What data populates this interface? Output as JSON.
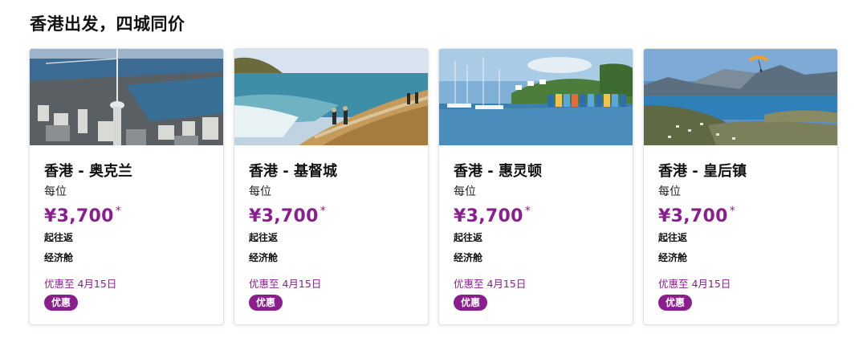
{
  "section": {
    "title": "香港出发，四城同价"
  },
  "cards": [
    {
      "route": "香港 - 奥克兰",
      "per": "每位",
      "price": "¥3,700",
      "star": "*",
      "trip": "起往返",
      "cabin": "经济舱",
      "deal_date": "优惠至 4月15日",
      "badge": "优惠",
      "image_icon": "auckland-city-photo"
    },
    {
      "route": "香港 - 基督城",
      "per": "每位",
      "price": "¥3,700",
      "star": "*",
      "trip": "起往返",
      "cabin": "经济舱",
      "deal_date": "优惠至 4月15日",
      "badge": "优惠",
      "image_icon": "christchurch-coast-photo"
    },
    {
      "route": "香港 - 惠灵顿",
      "per": "每位",
      "price": "¥3,700",
      "star": "*",
      "trip": "起往返",
      "cabin": "经济舱",
      "deal_date": "优惠至 4月15日",
      "badge": "优惠",
      "image_icon": "wellington-harbour-photo"
    },
    {
      "route": "香港 - 皇后镇",
      "per": "每位",
      "price": "¥3,700",
      "star": "*",
      "trip": "起往返",
      "cabin": "经济舱",
      "deal_date": "优惠至 4月15日",
      "badge": "优惠",
      "image_icon": "queenstown-lake-photo"
    }
  ],
  "colors": {
    "accent": "#8b1e8f",
    "badge_text": "#ffffff",
    "card_border": "#e3e3e3"
  }
}
